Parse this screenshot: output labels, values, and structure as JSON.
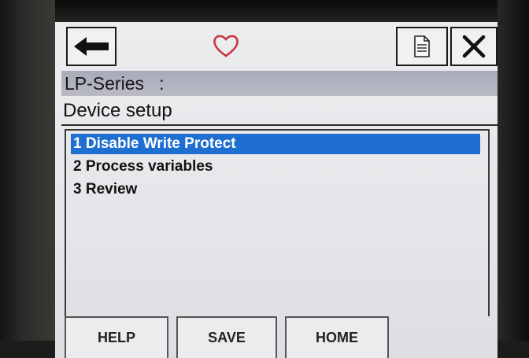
{
  "device": {
    "title": "LP-Series   :",
    "subtitle": "Device setup"
  },
  "toolbar": {
    "back_icon": "arrow-left-icon",
    "favorite_icon": "heart-icon",
    "document_icon": "document-icon",
    "close_icon": "close-icon",
    "heart_color": "#c8333c"
  },
  "menu": {
    "items": [
      {
        "label": "1 Disable Write Protect",
        "selected": true
      },
      {
        "label": "2 Process variables",
        "selected": false
      },
      {
        "label": "3 Review",
        "selected": false
      }
    ],
    "selection_color": "#1f6fd1"
  },
  "footer": {
    "help_label": "HELP",
    "save_label": "SAVE",
    "home_label": "HOME"
  }
}
